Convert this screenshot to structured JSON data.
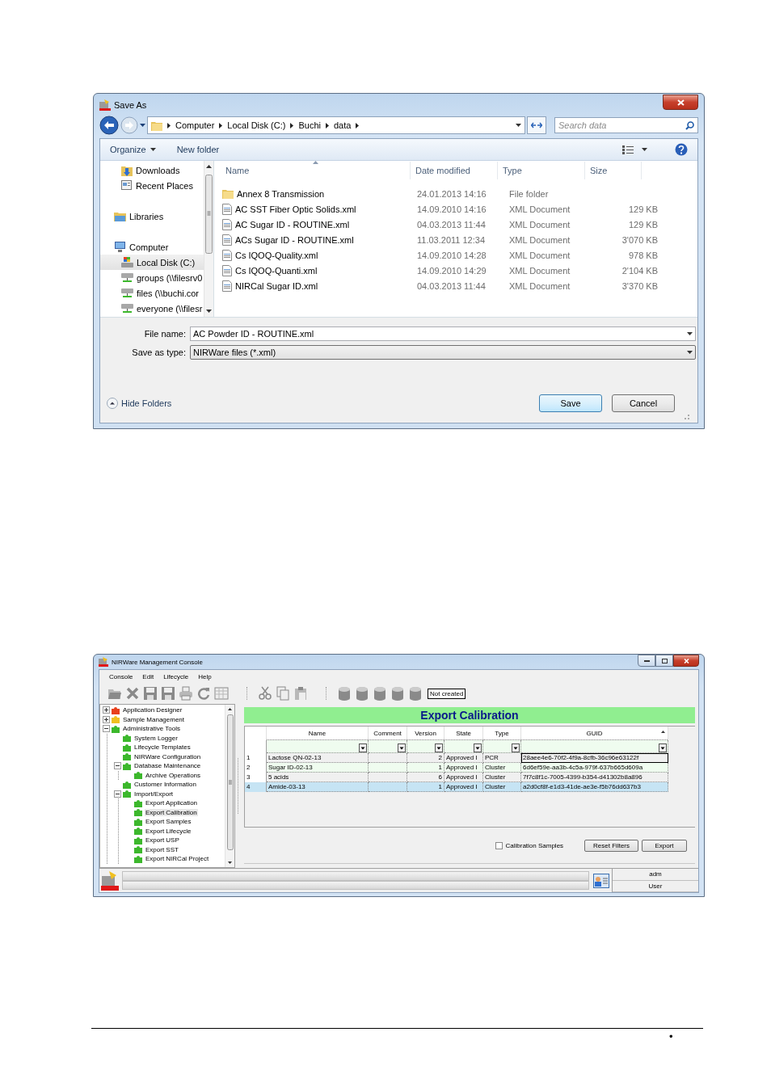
{
  "save_dialog": {
    "title": "Save As",
    "breadcrumb": [
      "Computer",
      "Local Disk (C:)",
      "Buchi",
      "data"
    ],
    "search": {
      "placeholder": "Search data"
    },
    "commands": {
      "organize": "Organize",
      "new_folder": "New folder"
    },
    "nav": [
      {
        "label": "Downloads",
        "kind": "downloads",
        "selected": false
      },
      {
        "label": "Recent Places",
        "kind": "recent",
        "selected": false
      },
      {
        "label": "Libraries",
        "kind": "library",
        "selected": false
      },
      {
        "label": "Computer",
        "kind": "computer",
        "selected": false,
        "children": [
          {
            "label": "Local Disk (C:)",
            "kind": "drive",
            "selected": true
          },
          {
            "label": "groups (\\\\filesrv0",
            "kind": "network",
            "selected": false
          },
          {
            "label": "files (\\\\buchi.cor",
            "kind": "network",
            "selected": false
          },
          {
            "label": "everyone (\\\\filesr",
            "kind": "network",
            "selected": false
          }
        ]
      }
    ],
    "columns": [
      "Name",
      "Date modified",
      "Type",
      "Size"
    ],
    "files": [
      {
        "name": "Annex 8 Transmission",
        "date": "24.01.2013 14:16",
        "type": "File folder",
        "kind": "folder"
      },
      {
        "name": "AC SST Fiber Optic Solids.xml",
        "date": "14.09.2010 14:16",
        "type": "XML Document",
        "size": "129 KB",
        "kind": "xml"
      },
      {
        "name": "AC Sugar ID - ROUTINE.xml",
        "date": "04.03.2013 11:44",
        "type": "XML Document",
        "size": "129 KB",
        "kind": "xml"
      },
      {
        "name": "ACs Sugar ID - ROUTINE.xml",
        "date": "11.03.2011 12:34",
        "type": "XML Document",
        "size": "3'070 KB",
        "kind": "xml"
      },
      {
        "name": "Cs IQOQ-Quality.xml",
        "date": "14.09.2010 14:28",
        "type": "XML Document",
        "size": "978 KB",
        "kind": "xml"
      },
      {
        "name": "Cs IQOQ-Quanti.xml",
        "date": "14.09.2010 14:29",
        "type": "XML Document",
        "size": "2'104 KB",
        "kind": "xml"
      },
      {
        "name": "NIRCal Sugar ID.xml",
        "date": "04.03.2013 11:44",
        "type": "XML Document",
        "size": "3'370 KB",
        "kind": "xml"
      }
    ],
    "file_name": {
      "label": "File name:",
      "value": "AC Powder ID - ROUTINE.xml"
    },
    "save_type": {
      "label": "Save as type:",
      "value": "NIRWare files (*.xml)"
    },
    "hide_folders": "Hide Folders",
    "buttons": [
      {
        "label": "Save",
        "default": true
      },
      {
        "label": "Cancel",
        "default": false
      }
    ]
  },
  "console": {
    "title": "NIRWare Management Console",
    "menu": [
      "Console",
      "Edit",
      "Lifecycle",
      "Help"
    ],
    "status_label": "Not created",
    "tree": [
      {
        "label": "Application Designer",
        "color": "#e8401c",
        "expanded": false,
        "selected": false
      },
      {
        "label": "Sample Management",
        "color": "#f0c020",
        "expanded": false,
        "selected": false
      },
      {
        "label": "Administrative Tools",
        "color": "#3cb82c",
        "expanded": true,
        "selected": false,
        "children": [
          {
            "label": "System Logger",
            "color": "#3cb82c",
            "selected": false
          },
          {
            "label": "Lifecycle Templates",
            "color": "#3cb82c",
            "selected": false
          },
          {
            "label": "NIRWare Configuration",
            "color": "#3cb82c",
            "selected": false
          },
          {
            "label": "Database Maintenance",
            "color": "#3cb82c",
            "expanded": true,
            "selected": false,
            "children": [
              {
                "label": "Archive Operations",
                "color": "#3cb82c",
                "selected": false
              }
            ]
          },
          {
            "label": "Customer Information",
            "color": "#3cb82c",
            "selected": false
          },
          {
            "label": "Import/Export",
            "color": "#3cb82c",
            "expanded": true,
            "selected": false,
            "children": [
              {
                "label": "Export Application",
                "color": "#3cb82c",
                "selected": false
              },
              {
                "label": "Export Calibration",
                "color": "#3cb82c",
                "selected": true
              },
              {
                "label": "Export Samples",
                "color": "#3cb82c",
                "selected": false
              },
              {
                "label": "Export Lifecycle",
                "color": "#3cb82c",
                "selected": false
              },
              {
                "label": "Export USP",
                "color": "#3cb82c",
                "selected": false
              },
              {
                "label": "Export SST",
                "color": "#3cb82c",
                "selected": false
              },
              {
                "label": "Export NIRCal Project",
                "color": "#3cb82c",
                "selected": false
              }
            ]
          }
        ]
      }
    ],
    "panel_title": "Export Calibration",
    "grid": {
      "columns": [
        "Name",
        "Comment",
        "Version",
        "State",
        "Type",
        "GUID"
      ],
      "rows": [
        {
          "number": "1",
          "name": "Lactose QN-02-13",
          "version": "2",
          "state": "Approved I",
          "type": "PCR",
          "guid": "28aee4e6-70f2-4f9a-8cfb-36c96e63122f",
          "focused": true,
          "selected": false
        },
        {
          "number": "2",
          "name": "Sugar ID-02-13",
          "version": "1",
          "state": "Approved I",
          "type": "Cluster",
          "guid": "6d6ef59e-aa3b-4c5a-979f-637b665d609a",
          "focused": false,
          "selected": false
        },
        {
          "number": "3",
          "name": "5 acids",
          "version": "6",
          "state": "Approved I",
          "type": "Cluster",
          "guid": "7f7c8f1c-7005-4399-b354-d41302b8a896",
          "focused": false,
          "selected": false
        },
        {
          "number": "4",
          "name": "Amide-03-13",
          "version": "1",
          "state": "Approved I",
          "type": "Cluster",
          "guid": "a2d0cf8f-e1d3-41de-ae3e-f5b76dd637b3",
          "focused": false,
          "selected": true
        }
      ]
    },
    "options": [
      {
        "label": "Calibration Samples",
        "checked": false
      }
    ],
    "buttons": [
      "Reset Filters",
      "Export"
    ],
    "status_bar": {
      "user": "adm",
      "role": "User"
    }
  },
  "footer": {
    "mark": "•"
  }
}
